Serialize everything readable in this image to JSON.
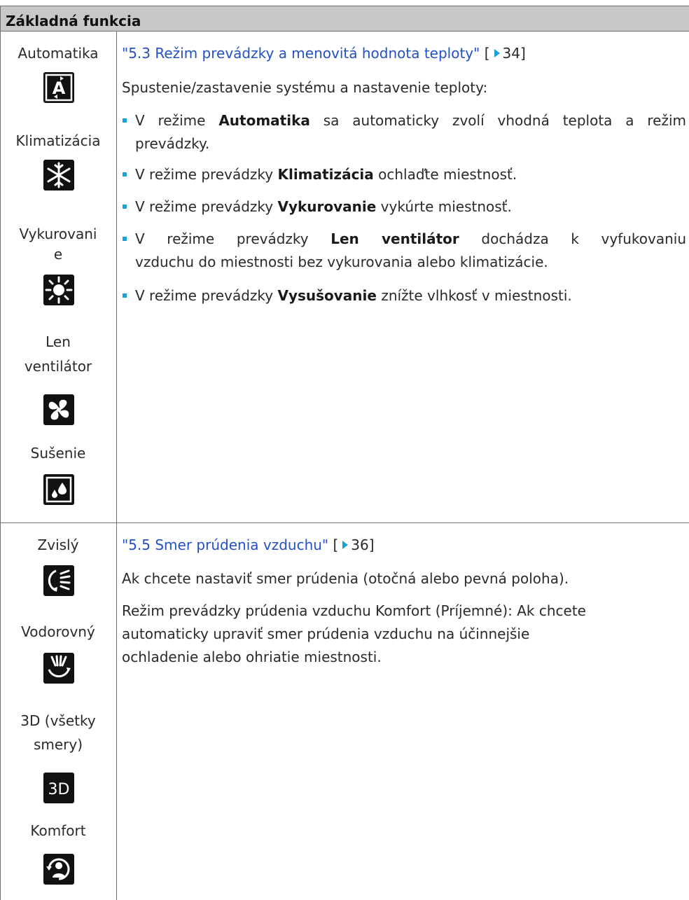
{
  "header": {
    "title": "Základná funkcia"
  },
  "section1": {
    "modes": [
      {
        "label": "Automatika",
        "icon": "auto-mode-icon"
      },
      {
        "label": "Klimatizácia",
        "icon": "snowflake-icon"
      },
      {
        "label_line1": "Vykurovani",
        "label_line2": "e",
        "icon": "sun-icon"
      },
      {
        "label_line1": "Len",
        "label_line2": "ventilátor",
        "icon": "fan-icon"
      },
      {
        "label": "Sušenie",
        "icon": "water-drop-icon"
      }
    ],
    "link": "\"5.3 Režim prevádzky a menovitá hodnota teploty\"",
    "link_page": "34",
    "intro": "Spustenie/zastavenie systému a nastavenie teploty:",
    "bullets": [
      {
        "pre": "V režime ",
        "bold": "Automatika",
        "post": " sa automaticky zvolí vhodná teplota a režim",
        "cont": "prevádzky."
      },
      {
        "pre": "V režime prevádzky ",
        "bold": "Klimatizácia",
        "post": " ochlaďte miestnosť."
      },
      {
        "pre": "V režime prevádzky ",
        "bold": "Vykurovanie",
        "post": " vykúrte miestnosť."
      },
      {
        "pre": "V režime prevádzky ",
        "bold": "Len ventilátor",
        "post": " dochádza k vyfukovaniu",
        "cont": "vzduchu do miestnosti bez vykurovania alebo klimatizácie."
      },
      {
        "pre": "V režime prevádzky ",
        "bold": "Vysušovanie",
        "post": " znížte vlhkosť v miestnosti."
      }
    ]
  },
  "section2": {
    "modes": [
      {
        "label": "Zvislý",
        "icon": "vertical-swing-icon"
      },
      {
        "label": "Vodorovný",
        "icon": "horizontal-swing-icon"
      },
      {
        "label_line1": "3D (všetky",
        "label_line2": "smery)",
        "icon": "3d-icon",
        "icon_text": "3D"
      },
      {
        "label": "Komfort",
        "icon": "comfort-airflow-icon"
      }
    ],
    "link": "\"5.5 Smer prúdenia vzduchu\"",
    "link_page": "36",
    "para1": "Ak chcete nastaviť smer prúdenia (otočná alebo pevná poloha).",
    "para2_line1": "Režim prevádzky prúdenia vzduchu Komfort (Príjemné): Ak chcete",
    "para2_line2": "automaticky upraviť smer prúdenia vzduchu na účinnejšie",
    "para2_line3": "ochladenie alebo ohriatie miestnosti."
  }
}
